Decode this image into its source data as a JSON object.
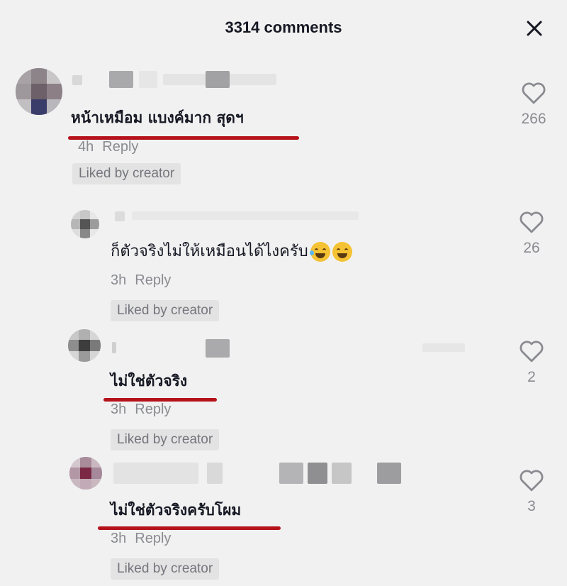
{
  "header": {
    "title": "3314 comments",
    "close_icon": "close-icon"
  },
  "comments": [
    {
      "text": "หน้าเหมือม แบงค์มาก สุดฯ",
      "time": "4h",
      "reply_label": "Reply",
      "liked_badge": "Liked by creator",
      "likes": "266"
    },
    {
      "text": "ก็ตัวจริงไม่ให้เหมือนได้ไงครับ",
      "time": "3h",
      "reply_label": "Reply",
      "liked_badge": "Liked by creator",
      "likes": "26",
      "emojis": [
        "laughing-emoji",
        "sweat-smile-emoji"
      ]
    },
    {
      "text": "ไม่ใช่ตัวจริง",
      "time": "3h",
      "reply_label": "Reply",
      "liked_badge": "Liked by creator",
      "likes": "2"
    },
    {
      "text": "ไม่ใช่ตัวจริงครับโผม",
      "time": "3h",
      "reply_label": "Reply",
      "liked_badge": "Liked by creator",
      "likes": "3"
    }
  ],
  "colors": {
    "background": "#f1f1f1",
    "underline": "#b5121b",
    "muted_text": "#8a8b91",
    "badge_bg": "#e3e3e4"
  }
}
